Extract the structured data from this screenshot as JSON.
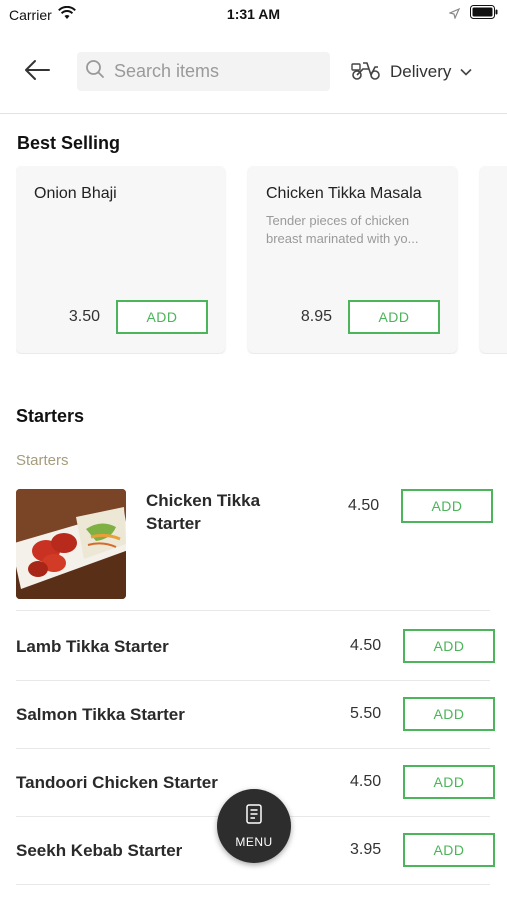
{
  "status_bar": {
    "carrier": "Carrier",
    "time": "1:31 AM"
  },
  "header": {
    "search_placeholder": "Search items",
    "delivery_label": "Delivery"
  },
  "best_selling": {
    "title": "Best Selling",
    "cards": [
      {
        "name": "Onion Bhaji",
        "description": "",
        "price": "3.50",
        "add_label": "ADD"
      },
      {
        "name": "Chicken Tikka Masala",
        "description": "Tender pieces of chicken breast marinated with yo...",
        "price": "8.95",
        "add_label": "ADD"
      }
    ]
  },
  "starters": {
    "title": "Starters",
    "subcategory": "Starters",
    "featured": {
      "name": "Chicken Tikka Starter",
      "price": "4.50",
      "add_label": "ADD"
    },
    "items": [
      {
        "name": "Lamb Tikka Starter",
        "price": "4.50",
        "add_label": "ADD"
      },
      {
        "name": "Salmon Tikka Starter",
        "price": "5.50",
        "add_label": "ADD"
      },
      {
        "name": "Tandoori Chicken Starter",
        "price": "4.50",
        "add_label": "ADD"
      },
      {
        "name": "Seekh Kebab Starter",
        "price": "3.95",
        "add_label": "ADD"
      }
    ]
  },
  "menu_button": {
    "label": "MENU"
  },
  "colors": {
    "accent_green": "#4cb45a",
    "subcategory_text": "#a59d7c",
    "fab_background": "#2d2d2d"
  },
  "icons": [
    "wifi-icon",
    "location-arrow-icon",
    "battery-icon",
    "back-arrow-icon",
    "search-icon",
    "scooter-icon",
    "chevron-down-icon",
    "menu-book-icon"
  ]
}
